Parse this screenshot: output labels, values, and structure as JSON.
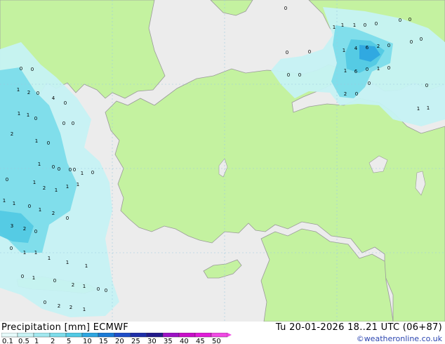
{
  "header": {
    "title": "Precipitation [mm]  ECMWF",
    "valid_time": "Tu 20-01-2026 18..21 UTC (06+87)",
    "credit": "©weatheronline.co.uk"
  },
  "legend": {
    "ticks": [
      "0.1",
      "0.5",
      "1",
      "2",
      "5",
      "10",
      "15",
      "20",
      "25",
      "30",
      "35",
      "40",
      "45",
      "50"
    ],
    "colors": [
      "#e6fafa",
      "#c6f2f4",
      "#a2e8ef",
      "#7cdcea",
      "#52c9e4",
      "#2ea6e0",
      "#1a7ad6",
      "#1e4ec8",
      "#1e2ea8",
      "#22198a",
      "#9c12c4",
      "#c80ec8",
      "#e01cd8",
      "#f04ae4"
    ]
  },
  "map": {
    "colors": {
      "land": "#c4f2a0",
      "sea": "#ececec",
      "precip_light": "#c6f2f4",
      "precip_medium": "#7cdcea",
      "precip_heavy": "#52c9e4",
      "precip_core": "#2ea6e0"
    },
    "labels": [
      {
        "text": "0"
      },
      {
        "text": "1"
      },
      {
        "text": "1"
      },
      {
        "text": "1"
      },
      {
        "text": "0"
      },
      {
        "text": "0"
      },
      {
        "text": "0"
      },
      {
        "text": "0"
      },
      {
        "text": "0"
      },
      {
        "text": "0"
      },
      {
        "text": "1"
      },
      {
        "text": "4"
      },
      {
        "text": "6"
      },
      {
        "text": "2"
      },
      {
        "text": "0"
      },
      {
        "text": "0"
      },
      {
        "text": "0"
      },
      {
        "text": "1"
      },
      {
        "text": "6"
      },
      {
        "text": "0"
      },
      {
        "text": "1"
      },
      {
        "text": "0"
      },
      {
        "text": "2"
      },
      {
        "text": "0"
      },
      {
        "text": "0"
      },
      {
        "text": "0"
      },
      {
        "text": "1"
      },
      {
        "text": "1"
      },
      {
        "text": "0"
      },
      {
        "text": "0"
      },
      {
        "text": "0"
      },
      {
        "text": "0"
      },
      {
        "text": "1"
      },
      {
        "text": "2"
      },
      {
        "text": "0"
      },
      {
        "text": "4"
      },
      {
        "text": "0"
      },
      {
        "text": "1"
      },
      {
        "text": "1"
      },
      {
        "text": "0"
      },
      {
        "text": "0"
      },
      {
        "text": "0"
      },
      {
        "text": "2"
      },
      {
        "text": "1"
      },
      {
        "text": "0"
      },
      {
        "text": "1"
      },
      {
        "text": "0"
      },
      {
        "text": "0"
      },
      {
        "text": "0"
      },
      {
        "text": "0"
      },
      {
        "text": "1"
      },
      {
        "text": "0"
      },
      {
        "text": "0"
      },
      {
        "text": "1"
      },
      {
        "text": "2"
      },
      {
        "text": "1"
      },
      {
        "text": "1"
      },
      {
        "text": "1"
      },
      {
        "text": "1"
      },
      {
        "text": "1"
      },
      {
        "text": "0"
      },
      {
        "text": "1"
      },
      {
        "text": "2"
      },
      {
        "text": "0"
      },
      {
        "text": "3"
      },
      {
        "text": "2"
      },
      {
        "text": "0"
      },
      {
        "text": "0"
      },
      {
        "text": "1"
      },
      {
        "text": "1"
      },
      {
        "text": "1"
      },
      {
        "text": "1"
      },
      {
        "text": "1"
      },
      {
        "text": "0"
      },
      {
        "text": "1"
      },
      {
        "text": "0"
      },
      {
        "text": "2"
      },
      {
        "text": "1"
      },
      {
        "text": "0"
      },
      {
        "text": "0"
      },
      {
        "text": "0"
      },
      {
        "text": "2"
      },
      {
        "text": "2"
      },
      {
        "text": "1"
      },
      {
        "text": "0"
      }
    ]
  }
}
